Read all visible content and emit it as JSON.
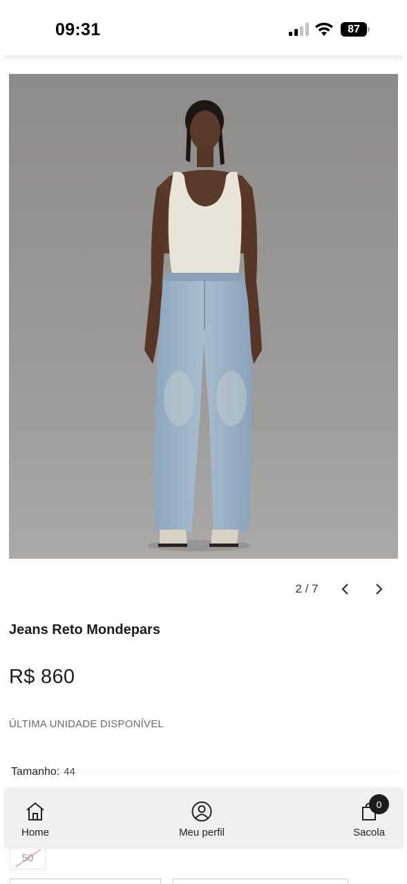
{
  "status_bar": {
    "time": "09:31",
    "battery_level": "87"
  },
  "gallery": {
    "counter": "2 / 7",
    "current_index": 2,
    "total": 7
  },
  "product": {
    "title": "Jeans Reto Mondepars",
    "price": "R$ 860",
    "stock_note": "ÚLTIMA UNIDADE DISPONÍVEL",
    "size_label": "Tamanho:",
    "size_value": "44",
    "visible_size_option": "50"
  },
  "bottom_nav": {
    "items": [
      {
        "label": "Home",
        "icon": "home-icon"
      },
      {
        "label": "Meu perfil",
        "icon": "user-circle-icon"
      },
      {
        "label": "Sacola",
        "icon": "shopping-bag-icon"
      }
    ],
    "cart_count": "0"
  },
  "colors": {
    "text_primary": "#1c1c1c",
    "text_muted": "#6a6a6a",
    "nav_bg": "#eeeeee",
    "badge_bg": "#1c1c1c",
    "photo_bg": "#9a9997"
  }
}
